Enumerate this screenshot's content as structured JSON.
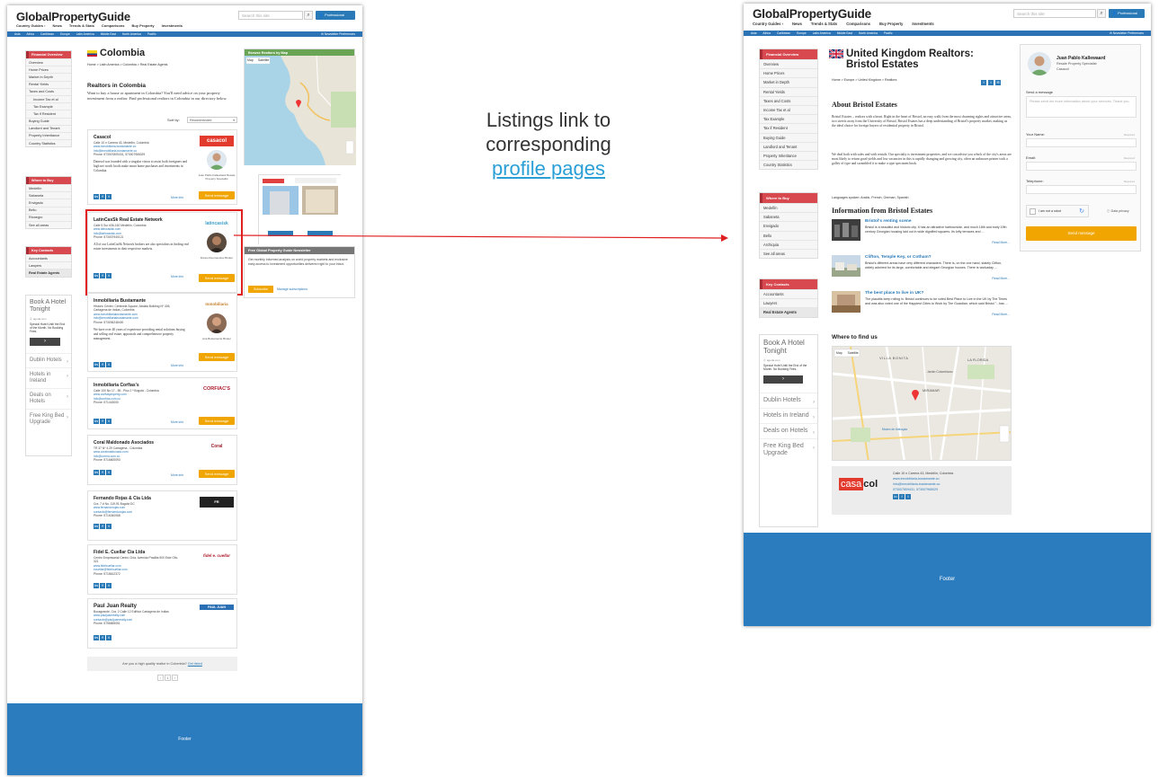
{
  "caption": {
    "line1": "Listings link to",
    "line2": "corresponding",
    "link": "profile pages"
  },
  "site": {
    "logo": "GlobalPropertyGuide",
    "nav": [
      "Country Guides ›",
      "News",
      "Trends & Stats",
      "Comparisons",
      "Buy Property",
      "Investments"
    ],
    "search_placeholder": "Search this site",
    "professional": "Professional",
    "regions": [
      "Asia",
      "Africa",
      "Caribbean",
      "Europe",
      "Latin America",
      "Middle East",
      "North America",
      "Pacific"
    ],
    "newsletter_pref": "Newsletter Preferences",
    "footer": "Footer"
  },
  "left_page": {
    "title": "Colombia",
    "breadcrumb": "Home > Latin America > Colombia > Real Estate Agents",
    "heading": "Realtors in Colombia",
    "intro": "Want to buy a house or apartment in Colombia? You'll need advice on your property investment from a realtor. Find professional realtors in Colombia in our directory below.",
    "sort_label": "Sort by:",
    "sort_value": "Recommended",
    "map_header": "Browse Realtors by Map",
    "map_tabs": [
      "Map",
      "Satellite"
    ],
    "newsletter_header": "Free Global Property Guide Newsletter",
    "newsletter_text": "Get monthly informed analysis on world property markets and exclusive early access to investment opportunities delivered right to your inbox.",
    "subscribe": "Subscribe",
    "manage": "Manage subscriptions",
    "quality": "Are you a high quality realtor in Colombia?",
    "quality_link": "Get listed",
    "pager": [
      "‹",
      "1",
      "›"
    ],
    "listings": [
      {
        "name": "Casacol",
        "addr": "Calle 10 n Carrera 43, Medellín, Colombia",
        "web": "www.inmobiliaria-bustamante.co",
        "email": "info@inmobiliaria-bustamante.co",
        "phone": "Phone: 573007809431, 573007965029",
        "desc": "Danesol was founded with a singular vision to assist both foreigners and high net worth locals make smart home purchases and investments in Colombia.",
        "logo": "casacol",
        "agent": "Juan Pablo Kallewaard Resale Property Specialist",
        "more": "More info",
        "msg": "Send message"
      },
      {
        "name": "LatinCasSk Real Estate Network",
        "addr": "Calle 5 Sur #36-160 Medellín, Colombia",
        "web": "www.latincasisk.com",
        "email": "info@latincasisk.com",
        "phone": "Phone: 573007940121",
        "desc": "All of our LatinCasSk Network brokers are also specialists in finding real estate investments in their respective markets.",
        "logo": "latincasisk",
        "agent": "Danso Reumaoutso Broker",
        "more": "More info",
        "msg": "Send message"
      },
      {
        "name": "Inmobiliaria Bustamante",
        "addr": "Historic Center, Centinela Square, Abdala Building Nº 406, Cartagena de Indias, Colombia",
        "web": "www.inmobiliariabustamante.com",
        "email": "info@inmobiliariabustamante.com",
        "phone": "Phone: 573006248400",
        "desc": "We have over 40 years of experience providing rental solutions buying and selling real estate, appraisals and comprehensive property management.",
        "logo": "Inmobiliaria",
        "agent": "Ana Bustamante Broker",
        "more": "More info",
        "msg": "Send message"
      },
      {
        "name": "Inmobiliaria Corfias's",
        "addr": "Calle 100 No 17 - 55 - Piso 2 ª Bogotá - Colombia",
        "web": "www.corfiasproperty.com",
        "email": "info@corfias.com.co",
        "phone": "Phone: 571443000",
        "desc": "",
        "logo": "CORFIAC'S",
        "agent": "",
        "more": "More info",
        "msg": "Send message"
      },
      {
        "name": "Coral Maldonado Asociados",
        "addr": "TR 37 Nº 4-29 Cartagena - Colombia",
        "web": "www.coralmaldonado.com",
        "email": "info@corma.com.co",
        "phone": "Phone: 5716600093",
        "desc": "",
        "logo": "Coral",
        "agent": "",
        "more": "More info",
        "msg": "Send message"
      },
      {
        "name": "Fernando Rojas & Cia Ltda",
        "addr": "Cra. 7 # No. 119-91 Bogotá DC",
        "web": "www.fernandorojas.com",
        "email": "contacto@fernandorojas.com",
        "phone": "Phone: 5716340068",
        "desc": "",
        "logo": "FR",
        "agent": "",
        "more": "",
        "msg": ""
      },
      {
        "name": "Fidel E. Cuellar Cia Ltda",
        "addr": "Centro Empresarial Centro Chía, Avenida Pradilla 900 Este Ofic. 321",
        "web": "www.fidelcuellar.com",
        "email": "ecuellar@fidelcuellar.com",
        "phone": "Phone: 5718612372",
        "desc": "",
        "logo": "fidel e. cuellar",
        "agent": "",
        "more": "",
        "msg": ""
      },
      {
        "name": "Paul Juan Realty",
        "addr": "Bocagrande, Cra. 2 Calle 12 Edificio Cartagena de Indias",
        "web": "www.pauljuanrealty.com",
        "email": "contacto@pauljuanrealty.com",
        "phone": "Phone: 5756655051",
        "desc": "",
        "logo": "PAUL JUAN",
        "agent": "",
        "more": "",
        "msg": ""
      }
    ]
  },
  "sidebar": {
    "financial_head": "Financial Overview",
    "financial_items": [
      "Overview",
      "Home Prices",
      "Market in Depth",
      "Rental Yields",
      "Taxes and Costs"
    ],
    "tax_sub": [
      "Income Tax et al",
      "Tax Example",
      "Tax if Resident"
    ],
    "financial_items2": [
      "Buying Guide",
      "Landlord and Tenant",
      "Property Inheritance",
      "Country Statistics"
    ],
    "where_head": "Where to Buy",
    "where_left": [
      "Medellín",
      "Sabaneta",
      "Envigado",
      "Bello",
      "Rionegro",
      "See all areas"
    ],
    "where_right": [
      "Medellín",
      "Sabaneta",
      "Envigado",
      "Bello",
      "Archiquia",
      "See all areas"
    ],
    "key_head": "Key Contacts",
    "key_items": [
      "Accountants",
      "Lawyers",
      "Real Estate Agents"
    ],
    "ad": {
      "title": "Book A Hotel Tonight",
      "url": "Ⓒ agoda.com",
      "text": "Special Hotel Until the End of the Month. No Booking Fees.",
      "links": [
        "Dublin Hotels",
        "Hotels in Ireland",
        "Deals on Hotels",
        "Free King Bed Upgrade"
      ]
    }
  },
  "right_page": {
    "title": "United Kingdom Realtors: Bristol Estates",
    "breadcrumb": "Home > Europe > United Kingdom > Realtors",
    "about_head": "About Bristol Estates",
    "about_p1": "Bristol Estates – realtors with a heart. Right in the heart of Bristol, an easy walk from the most charming sights and attractive areas, two streets away from the University of Bristol, Bristol Estates has a deep understanding of Bristol's property market, making us the ideal choice for foreign buyers of residential property in Bristol.",
    "about_p2": "We deal both with sales and with rentals. Our specialty is investment properties, and we can advise you which of the city's areas are most likely to return good yields and low vacancies in this is rapidly changing and growing city, often an unknown printer took a galley of type and scrambled it to make a type specimen book.",
    "languages": "Languages spoken: Arabic, French, German, Spanish",
    "info_head": "Information from Bristol Estates",
    "articles": [
      {
        "title": "Bristol's renting scene",
        "text": "Bristol is a beautiful and historic city. It has an attractive harbourside, and much 18th and early 19th century Georgian housing laid out in wide dignified squares. Its lofty terraces and ...",
        "more": "Read More..."
      },
      {
        "title": "Clifton, Temple Key, or Cotham?",
        "text": "Bristol's different areas have very different characters. There is, on the one hand, stately Clifton, widely admired for its large, comfortable and elegant Georgian houses. There is workaday ...",
        "more": "Read More..."
      },
      {
        "title": "The best place to live in UK?",
        "text": "The plaudits keep rolling in. Bristol continues to be voted Best Place to Live in the UK by The Times and was also voted one of the Happiest Cities to Work by The Guardian, which said Bristol \"...has ...",
        "more": "Read More..."
      }
    ],
    "where_head": "Where to find us",
    "map_tabs": [
      "Map",
      "Satellite"
    ],
    "map_labels": [
      "VILLA BONITA",
      "LA FLORIDA",
      "Jardín Colombiano",
      "MIRAMAR",
      "Museo de Antioquia"
    ],
    "contact": {
      "addr": "Calle 10 n Carrera 43, Medellín, Colombia",
      "web": "www.inmobiliaria-bustamante.co",
      "email": "info@inmobiliaria-bustamante.co",
      "phone": "573007809431, 573007965029",
      "logo_a": "casa",
      "logo_b": "col"
    },
    "agent": {
      "name": "Juan Pablo Kallewaard",
      "role": "Resale Property Specialist",
      "company": "Casacol"
    },
    "form": {
      "send_label": "Send a message",
      "msg_placeholder": "Please send me more information about your services. Thank you.",
      "name_label": "Your Name:",
      "email_label": "Email:",
      "phone_label": "Telephone:",
      "required": "Required",
      "robot": "I am not a robot",
      "privacy": "Data privacy",
      "send_button": "Send message"
    }
  },
  "colors": {
    "blue": "#2b73b4",
    "red": "#d8484f",
    "orange": "#f0a500",
    "footer": "#2b7bbf",
    "highlight": "#e02020"
  }
}
